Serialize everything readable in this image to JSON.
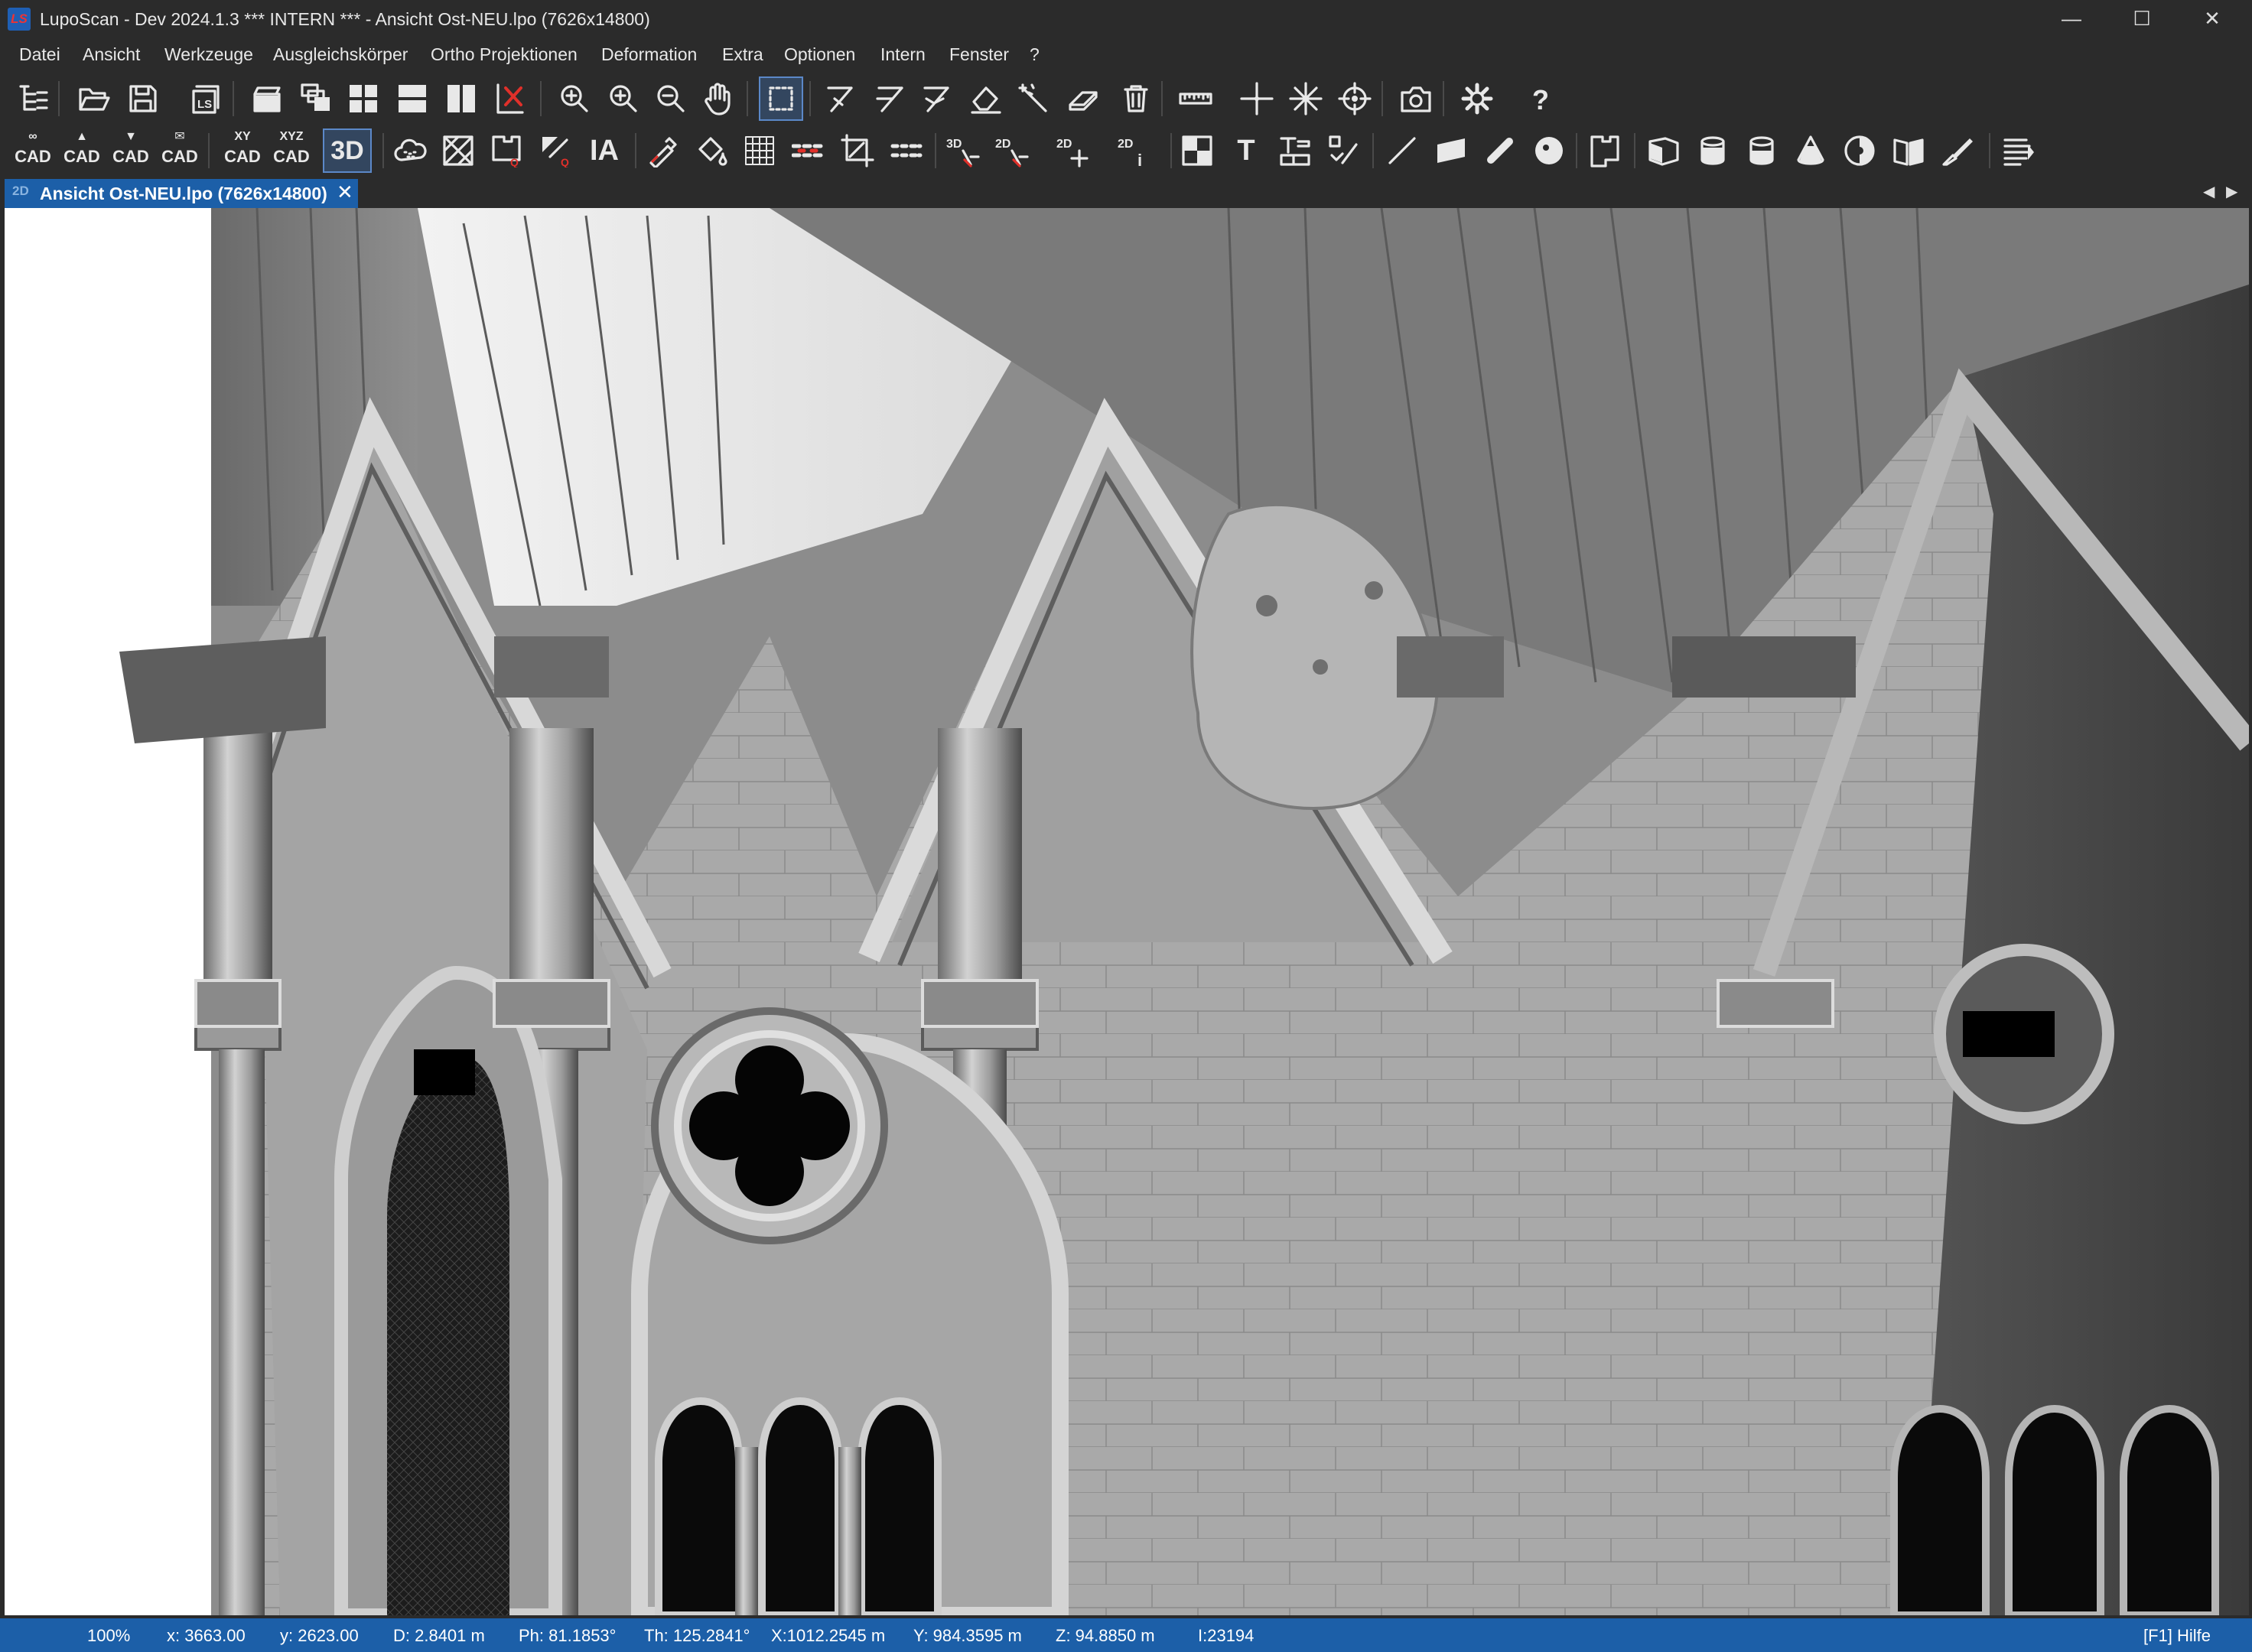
{
  "window": {
    "title": "LupoScan - Dev 2024.1.3 *** INTERN *** - Ansicht Ost-NEU.lpo (7626x14800)",
    "logo_text": "LS",
    "minimize": "—",
    "maximize": "☐",
    "close": "✕"
  },
  "menu": [
    "Datei",
    "Ansicht",
    "Werkzeuge",
    "Ausgleichskörper",
    "Ortho Projektionen",
    "Deformation",
    "Extra",
    "Optionen",
    "Intern",
    "Fenster",
    "?"
  ],
  "toolbar2_text": {
    "cad1_top": "∞",
    "cad1": "CAD",
    "cad2_top": "▲",
    "cad2": "CAD",
    "cad3_top": "▼",
    "cad3": "CAD",
    "cad4_top": "✉",
    "cad4": "CAD",
    "xycad_top": "XY",
    "xycad": "CAD",
    "xyzcad_top": "XYZ",
    "xyzcad": "CAD",
    "btn3d": "3D",
    "btnia": "IA",
    "d3_label": "3D",
    "d2a_label": "2D",
    "d2b_label": "2D",
    "d2c_label": "2D",
    "d2c_sub": "i",
    "text_tool": "T"
  },
  "tab": {
    "icon": "2D",
    "label": "Ansicht Ost-NEU.lpo (7626x14800)",
    "close": "✕",
    "scroll_left": "◀",
    "scroll_right": "▶"
  },
  "status": {
    "zoom": "100%",
    "x": "x:  3663.00",
    "y": "y:  2623.00",
    "d": "D: 2.8401 m",
    "ph": "Ph:  81.1853°",
    "th": "Th: 125.2841°",
    "X": "X:1012.2545 m",
    "Y": "Y: 984.3595 m",
    "Z": "Z:  94.8850 m",
    "i": "I:23194",
    "help": "[F1] Hilfe"
  },
  "colors": {
    "chrome_bg": "#2b2b2b",
    "accent_blue": "#1c5fa8",
    "icon_fg": "#e8e8e8"
  }
}
